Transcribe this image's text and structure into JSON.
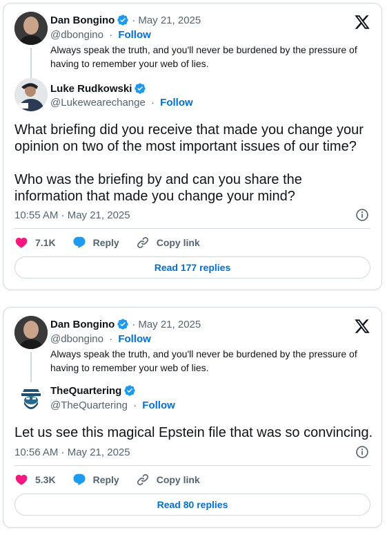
{
  "tweets": [
    {
      "quoted": {
        "name": "Dan Bongino",
        "date": "May 21, 2025",
        "handle": "@dbongino",
        "follow": "Follow",
        "text": "Always speak the truth, and you'll never be burdened by the pressure of having to remember your web of lies."
      },
      "author": {
        "name": "Luke Rudkowski",
        "handle": "@Lukewearechange",
        "follow": "Follow"
      },
      "text": "What briefing did you receive that made you change your opinion on two of the most important issues of our time?\n\nWho was the briefing by and can you share the information that made you change your mind?",
      "timestamp": "10:55 AM · May 21, 2025",
      "likes": "7.1K",
      "reply_label": "Reply",
      "copy_label": "Copy link",
      "read_replies": "Read 177 replies"
    },
    {
      "quoted": {
        "name": "Dan Bongino",
        "date": "May 21, 2025",
        "handle": "@dbongino",
        "follow": "Follow",
        "text": "Always speak the truth, and you'll never be burdened by the pressure of having to remember your web of lies."
      },
      "author": {
        "name": "TheQuartering",
        "handle": "@TheQuartering",
        "follow": "Follow"
      },
      "text": "Let us see this magical Epstein file that was so convincing.",
      "timestamp": "10:56 AM · May 21, 2025",
      "likes": "5.3K",
      "reply_label": "Reply",
      "copy_label": "Copy link",
      "read_replies": "Read 80 replies"
    }
  ],
  "icons": {
    "logo": "x-logo-icon",
    "verified": "verified-badge-icon",
    "like": "heart-icon",
    "reply": "speech-bubble-icon",
    "copy": "link-icon",
    "info": "info-icon"
  },
  "colors": {
    "verified": "#1d9bf0",
    "like": "#f91880",
    "reply": "#1d9bf0",
    "link": "#006fd6",
    "muted": "#536471",
    "border": "#cfd9de"
  }
}
